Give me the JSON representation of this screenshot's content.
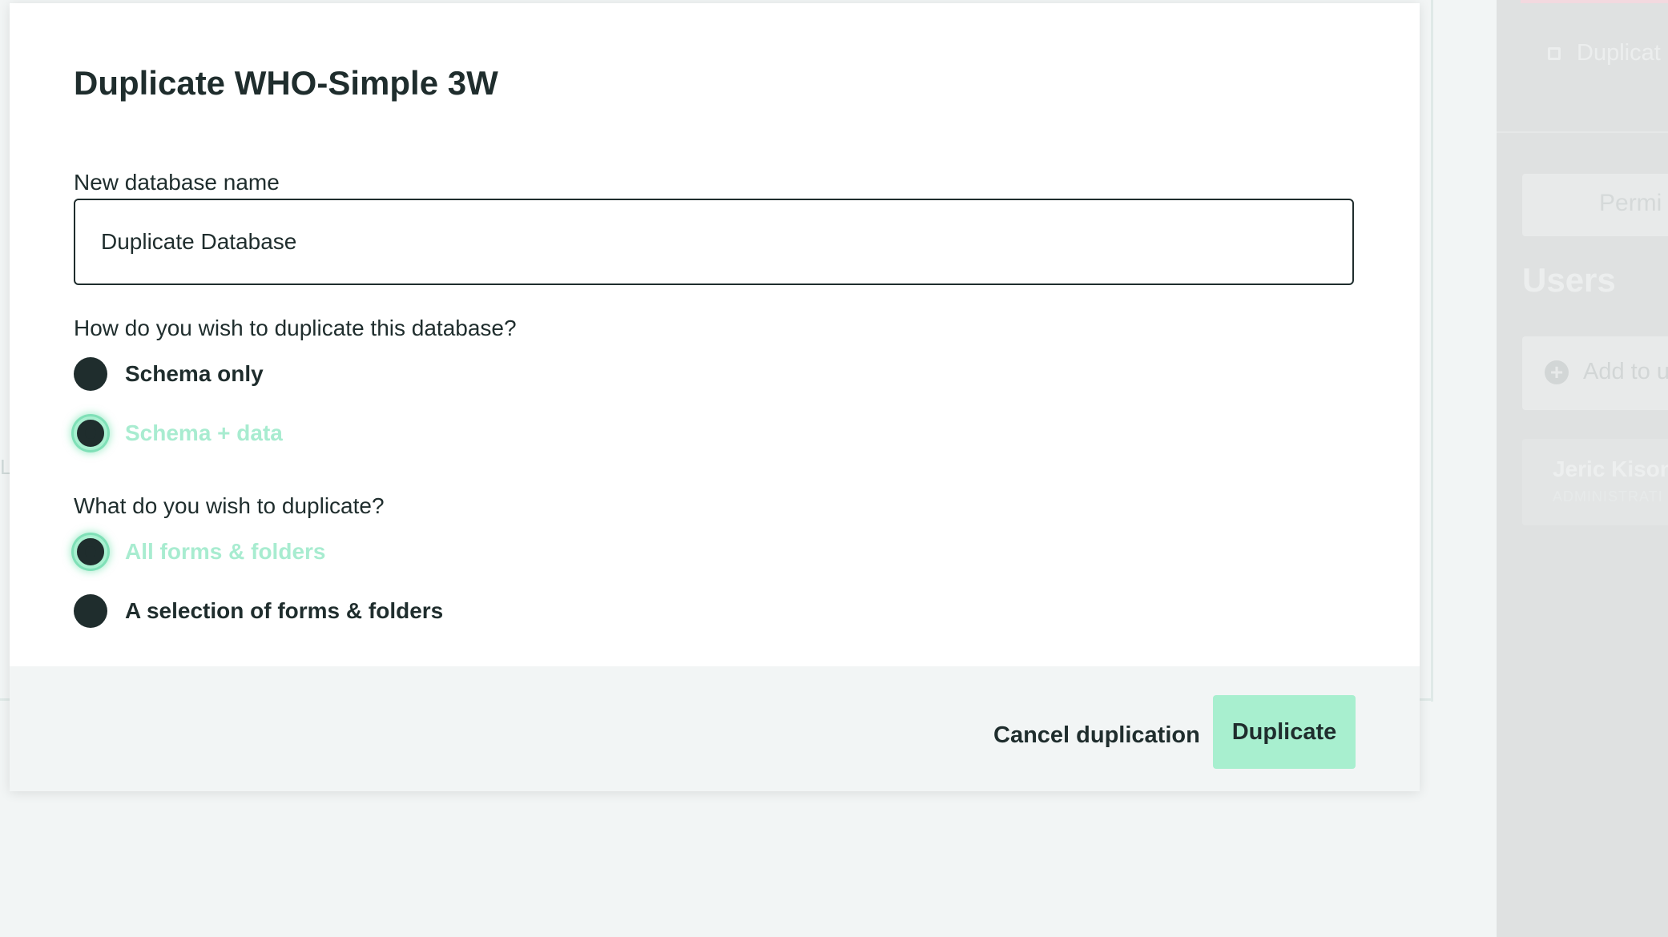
{
  "dialog": {
    "title": "Duplicate WHO-Simple 3W",
    "name_label": "New database name",
    "name_value": "Duplicate Database",
    "mode_question": "How do you wish to duplicate this database?",
    "mode_options": [
      {
        "label": "Schema only",
        "selected": false
      },
      {
        "label": "Schema + data",
        "selected": true
      }
    ],
    "scope_question": "What do you wish to duplicate?",
    "scope_options": [
      {
        "label": "All forms & folders",
        "selected": true
      },
      {
        "label": "A selection of forms & folders",
        "selected": false
      }
    ],
    "cancel_label": "Cancel duplication",
    "submit_label": "Duplicate"
  },
  "background": {
    "letter": "L"
  },
  "side_panel": {
    "duplicate_label": "Duplicat",
    "tab_label": "Permi",
    "users_heading": "Users",
    "add_label": "Add to u",
    "user_name": "Jeric Kison",
    "user_role": "ADMINISTRATI"
  },
  "colors": {
    "accent": "#a8efcf",
    "text": "#1f2d2d",
    "footer_bg": "#f2f5f5"
  }
}
